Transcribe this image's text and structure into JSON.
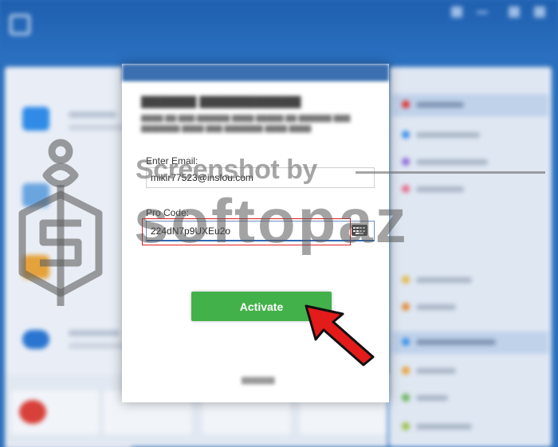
{
  "dialog": {
    "email_label": "Enter Email:",
    "email_value": "mikir77523@insfou.com",
    "code_label": "Pro Code:",
    "code_value": "224dN7p9UXEu2o",
    "activate_label": "Activate"
  },
  "watermark": {
    "caption": "Screenshot by",
    "brand": "softopaz"
  },
  "icons": {
    "keyboard": "keyboard-icon",
    "arrow": "red-pointer-arrow",
    "logo": "softopaz-logo-icon"
  },
  "colors": {
    "accent_green": "#43b14a",
    "highlight_red": "#e02020",
    "titlebar_blue": "#2b71c2"
  }
}
